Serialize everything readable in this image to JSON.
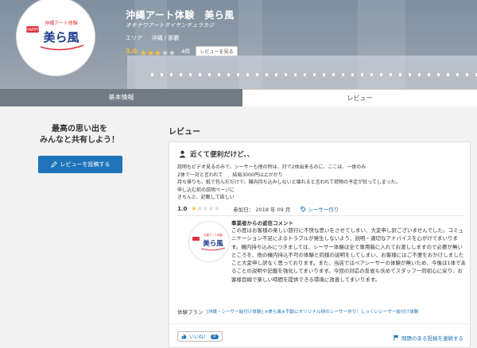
{
  "shop": {
    "name": "沖縄アート体験　美ら風",
    "kana": "オキナワアートタイケンチュラカジ",
    "area_label": "エリア",
    "area_value": "沖縄 / 那覇",
    "rating": "3.0",
    "rating_value": 3,
    "review_count": "4件",
    "see_reviews_button": "レビューを見る",
    "logo_text_small": "沖縄アート体験",
    "logo_text_big": "美ら風",
    "logo_badge": "HAPPY"
  },
  "tabs": [
    {
      "label": "基本情報"
    },
    {
      "label": "レビュー"
    }
  ],
  "left": {
    "share_line1": "最高の思い出を",
    "share_line2": "みんなと共有しよう！",
    "post_button": "レビューを投稿する"
  },
  "reviews_heading": "レビュー",
  "review": {
    "title": "近くて便利だけど、、",
    "body": [
      "説明もビデオ見るのみで、シーサーも他の所は、対で2体出来るのに、ここは、一体のみ",
      "2体で一対と言われて　　結局3000円以上かかり",
      "持ち帰りも、紙で包んだだけで、機内持ち込みしないと壊れると言われて荷物の予定が狂ってしまった。",
      "申し込む前の説明ページに",
      "きちんと、記載して欲しい"
    ],
    "score": "1.0",
    "score_value": 1,
    "date": "参加日： 2018 年 09 月",
    "tag": "シーサー作り",
    "reply_title": "事業者からの返信コメント",
    "reply_body": "この度はお客様の楽しい旅行に不快な思いをさせてしまい、大変申し訳ございませんでした。コミュニケーション不足によるトラブルが発生しないよう、説明・適切なアドバイスを心がけてまいります。機内持ち込みにつきましては、シーサー体験は全て専用箱に入れてお渡ししますので必要が無いところを、他の機内持込不可の体験と同様の説明をしてしまい、お客様にはご不便をおかけしましたこと大変申し訳なく思っております。また、当店ではペアシーサーの体験が無いため、今後は1体であることの説明や記載を強化してまいります。今回の対応の反省も含めてスタッフ一同初心に戻り、お客様目線で楽しい時間を提供できる環境に改善してまいります。",
    "plan_label": "体験プラン",
    "plan_link": "[沖縄・シーサー絵付け体験] ※美ら風※手動にオリジナル柄のシーサー作り！しっくいシーサー絵付け体験",
    "like_label": "いいね！",
    "like_count": "0",
    "report_link": "問題のある投稿を連絡する"
  }
}
